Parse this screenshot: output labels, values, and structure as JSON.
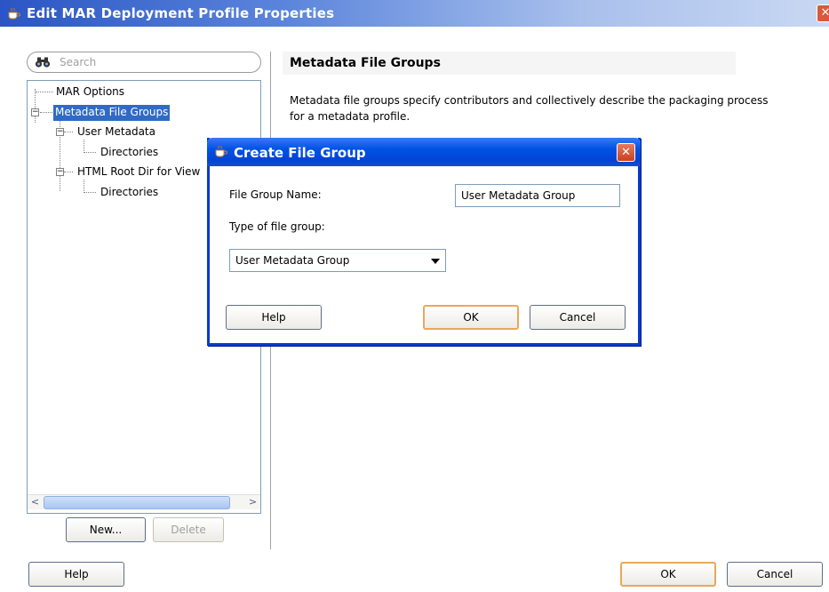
{
  "window": {
    "title": "Edit MAR Deployment Profile Properties",
    "close_label": "✕"
  },
  "search": {
    "placeholder": "Search"
  },
  "tree": {
    "items": [
      {
        "label": "MAR Options"
      },
      {
        "label": "Metadata File Groups",
        "selected": true
      },
      {
        "label": "User Metadata"
      },
      {
        "label": "Directories"
      },
      {
        "label": "HTML Root Dir for View"
      },
      {
        "label": "Directories"
      }
    ]
  },
  "left_buttons": {
    "new": "New...",
    "delete": "Delete"
  },
  "section": {
    "title": "Metadata File Groups",
    "description_line1": "Metadata file groups specify contributors and collectively describe the packaging process",
    "description_line2": "for a metadata profile."
  },
  "dialog": {
    "title": "Create File Group",
    "close_label": "✕",
    "name_label": "File Group Name:",
    "name_value": "User Metadata Group",
    "type_label": "Type of file group:",
    "type_value": "User Metadata Group",
    "help": "Help",
    "ok": "OK",
    "cancel": "Cancel"
  },
  "footer": {
    "help": "Help",
    "ok": "OK",
    "cancel": "Cancel"
  },
  "colors": {
    "title_gradient_start": "#2a55c4",
    "dialog_title": "#0052e4",
    "selection": "#316ac5",
    "default_button_border": "#e7a95a"
  }
}
